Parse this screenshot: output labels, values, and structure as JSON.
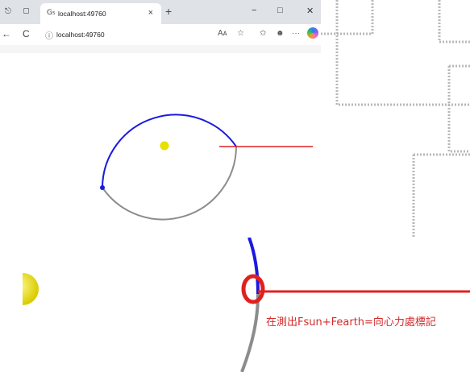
{
  "browser": {
    "tab": {
      "favicon": "G₅",
      "title": "localhost:49760",
      "close": "×"
    },
    "new_tab": "+",
    "window_controls": {
      "minimize": "−",
      "maximize": "□",
      "close": "✕"
    },
    "nav": {
      "back": "←",
      "refresh": "C"
    },
    "address": {
      "url": "localhost:49760"
    },
    "toolbar_icons": {
      "read_aloud": "Aᴀ",
      "favorite": "☆",
      "favorites": "✩",
      "profile": "☻",
      "more": "···"
    }
  },
  "colors": {
    "orbit_upper": "#1a1ae0",
    "orbit_lower": "#8c8c8c",
    "force_line": "#e02020",
    "sun": "#e8e000",
    "annotation": "#d42a2a"
  },
  "zoom": {
    "annotation": "在測出Fsun+Fearth=向心力處標記"
  }
}
